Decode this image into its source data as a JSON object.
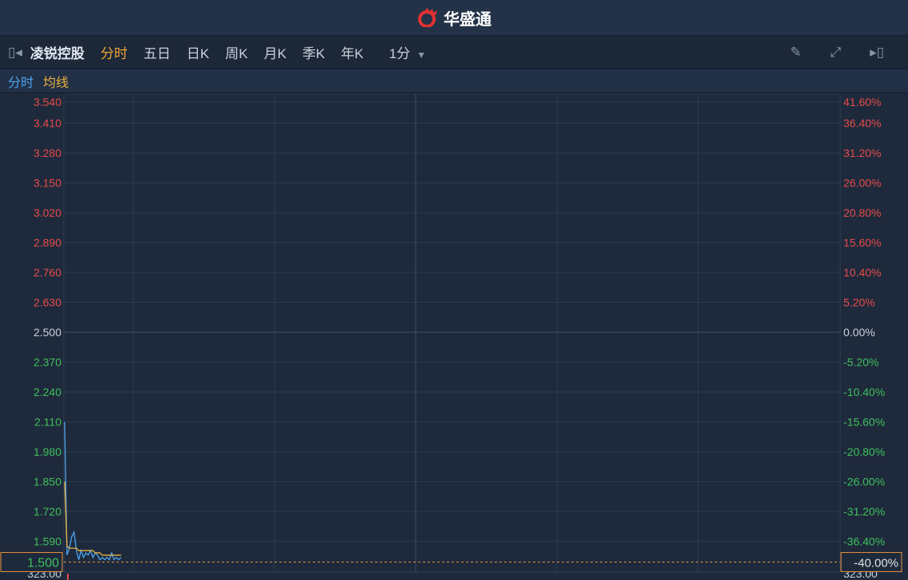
{
  "header": {
    "brand": "华盛通",
    "logo_icon": "huasheng-logo"
  },
  "toolbar": {
    "stock_name": "凌锐控股",
    "tabs": [
      "分时",
      "五日",
      "日K",
      "周K",
      "月K",
      "季K",
      "年K"
    ],
    "active_tab": "分时",
    "interval": "1分"
  },
  "legend": {
    "price": "分时",
    "avg": "均线"
  },
  "colors": {
    "up": "#e84a4a",
    "down": "#3fbf5a",
    "price_line": "#4ca3f0",
    "avg_line": "#e8b13c",
    "crosshair": "#e8913c"
  },
  "chart_data": {
    "type": "line",
    "ylim": [
      1.5,
      3.54
    ],
    "base_price": 2.5,
    "left_ticks": [
      "3.540",
      "3.410",
      "3.280",
      "3.150",
      "3.020",
      "2.890",
      "2.760",
      "2.630",
      "2.500",
      "2.370",
      "2.240",
      "2.110",
      "1.980",
      "1.850",
      "1.720",
      "1.590"
    ],
    "right_ticks": [
      "41.60%",
      "36.40%",
      "31.20%",
      "26.00%",
      "20.80%",
      "15.60%",
      "10.40%",
      "5.20%",
      "0.00%",
      "-5.20%",
      "-10.40%",
      "-15.60%",
      "-20.80%",
      "-26.00%",
      "-31.20%",
      "-36.40%"
    ],
    "crosshair_left": "1.500",
    "crosshair_right": "-40.00%",
    "bottom_label": "323.00",
    "minutes_total": 330,
    "series": [
      {
        "name": "分时",
        "values": [
          2.11,
          1.53,
          1.56,
          1.61,
          1.63,
          1.55,
          1.51,
          1.55,
          1.52,
          1.54,
          1.53,
          1.55,
          1.52,
          1.54,
          1.53,
          1.51,
          1.52,
          1.51,
          1.52,
          1.51,
          1.54,
          1.51,
          1.52,
          1.51,
          1.52
        ]
      },
      {
        "name": "均线",
        "values": [
          1.85,
          1.57,
          1.56,
          1.56,
          1.56,
          1.56,
          1.55,
          1.55,
          1.55,
          1.55,
          1.55,
          1.55,
          1.55,
          1.54,
          1.54,
          1.54,
          1.53,
          1.53,
          1.53,
          1.53,
          1.53,
          1.53,
          1.53,
          1.53,
          1.53
        ]
      }
    ]
  }
}
